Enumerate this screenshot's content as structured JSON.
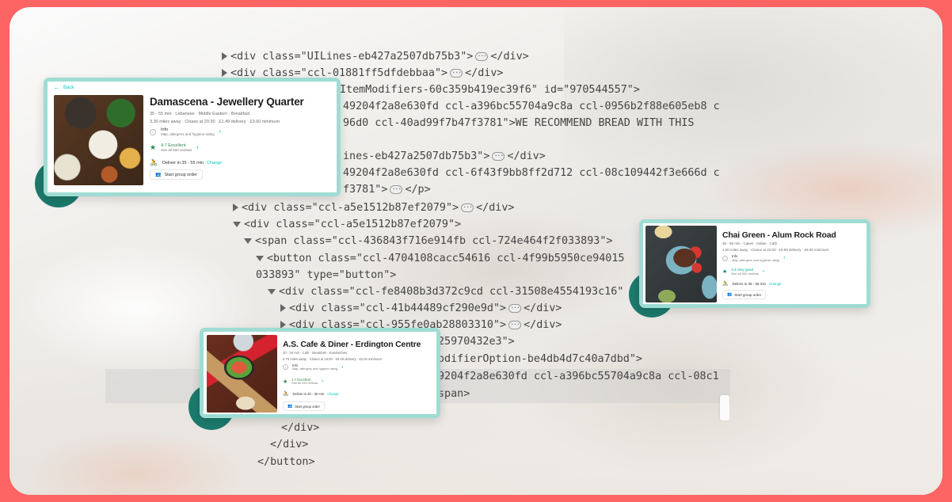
{
  "code_view": {
    "lines": [
      {
        "indent": 0,
        "toggle": "right",
        "text": "<div class=\"UILines-eb427a2507db75b3\">",
        "collapsed": true,
        "close": "</div>"
      },
      {
        "indent": 0,
        "toggle": "right",
        "text": "<div class=\"ccl-01881ff5dfdebbaa\">",
        "collapsed": true,
        "close": "</div>"
      },
      {
        "indent": 0,
        "toggle": "",
        "text": "ItemModifiers-60c359b419ec39f6\" id=\"970544557\">",
        "collapsed": false,
        "close": ""
      },
      {
        "indent": 0,
        "toggle": "",
        "text": "49204f2a8e630fd ccl-a396bc55704a9c8a ccl-0956b2f88e605eb8 c",
        "collapsed": false,
        "close": ""
      },
      {
        "indent": 0,
        "toggle": "",
        "text": "96d0 ccl-40ad99f7b47f3781\">WE RECOMMEND BREAD WITH THIS",
        "collapsed": false,
        "close": ""
      },
      {
        "indent": 0,
        "toggle": "",
        "text": "ines-eb427a2507db75b3\">",
        "collapsed": true,
        "close": "</div>"
      },
      {
        "indent": 0,
        "toggle": "",
        "text": "49204f2a8e630fd ccl-6f43f9bb8ff2d712 ccl-08c109442f3e666d c",
        "collapsed": false,
        "close": ""
      },
      {
        "indent": 0,
        "toggle": "",
        "text": "f3781\">",
        "collapsed": true,
        "close": "</p>"
      },
      {
        "indent": 0,
        "toggle": "right",
        "text": "<div class=\"ccl-a5e1512b87ef2079\">",
        "collapsed": true,
        "close": "</div>"
      },
      {
        "indent": 0,
        "toggle": "down",
        "text": "<div class=\"ccl-a5e1512b87ef2079\">",
        "collapsed": false,
        "close": ""
      },
      {
        "indent": 1,
        "toggle": "down",
        "text": "<span class=\"ccl-436843f716e914fb ccl-724e464f2f033893\">",
        "collapsed": false,
        "close": ""
      },
      {
        "indent": 2,
        "toggle": "down",
        "text": "<button class=\"ccl-4704108cacc54616 ccl-4f99b5950ce94015",
        "collapsed": false,
        "close": ""
      },
      {
        "indent": 2,
        "toggle": "",
        "text": "033893\" type=\"button\">",
        "collapsed": false,
        "close": ""
      },
      {
        "indent": 3,
        "toggle": "down",
        "text": "<div class=\"ccl-fe8408b3d372c9cd ccl-31508e4554193c16\"",
        "collapsed": false,
        "close": ""
      },
      {
        "indent": 4,
        "toggle": "right",
        "text": "<div class=\"ccl-41b44489cf290e9d\">",
        "collapsed": true,
        "close": "</div>"
      },
      {
        "indent": 4,
        "toggle": "right",
        "text": "<div class=\"ccl-955fe0ab28803310\">",
        "collapsed": true,
        "close": "</div>"
      },
      {
        "indent": 0,
        "toggle": "",
        "text": "25970432e3\">",
        "collapsed": false,
        "close": ""
      },
      {
        "indent": 0,
        "toggle": "",
        "text": "odifierOption-be4db4d7c40a7dbd\">",
        "collapsed": false,
        "close": ""
      },
      {
        "indent": 0,
        "toggle": "",
        "text": "9204f2a8e630fd ccl-a396bc55704a9c8a ccl-08c1",
        "collapsed": false,
        "close": ""
      },
      {
        "indent": 0,
        "toggle": "",
        "text": "span>",
        "collapsed": false,
        "close": ""
      },
      {
        "indent": 0,
        "toggle": "",
        "text": "</div>",
        "collapsed": false,
        "close": ""
      },
      {
        "indent": 0,
        "toggle": "",
        "text": "</div>",
        "collapsed": false,
        "close": ""
      },
      {
        "indent": 0,
        "toggle": "",
        "text": "</button>",
        "collapsed": false,
        "close": ""
      }
    ],
    "ellipsis_label": "···"
  },
  "cards": [
    {
      "back_label": "Back",
      "name": "Damascena - Jewellery Quarter",
      "meta1": "35 - 55 min · Lebanese · Middle Eastern · Breakfast",
      "meta2": "3.30 miles away · Closes at 20:30 · £1.49 delivery · £9.60 minimum",
      "info_label": "Info",
      "info_sub": "Map, allergens and hygiene rating",
      "rating_label": "4.7 Excellent",
      "rating_sub": "See all 500 reviews",
      "deliver_label": "Deliver in 35 - 55 min",
      "change_label": "Change",
      "group_order_label": "Start group order",
      "rating_color": "#2e8a48"
    },
    {
      "name": "Chai Green - Alum Rock Road",
      "meta1": "35 - 55 min · Cakes · Indian · Café",
      "meta2": "1.90 miles away · Closes at 22:00 · £0.99 delivery · £9.00 minimum",
      "info_label": "Info",
      "info_sub": "Map, allergens and hygiene rating",
      "rating_label": "4.3 Very good",
      "rating_sub": "See all 500 reviews",
      "deliver_label": "Deliver in 35 - 55 min",
      "change_label": "Change",
      "group_order_label": "Start group order",
      "rating_color": "#00a699"
    },
    {
      "name": "A.S. Cafe & Diner - Erdington Centre",
      "meta1": "20 - 30 min · Café · Breakfast · Sandwiches",
      "meta2": "0.70 miles away · Closes at 16:00 · £0.49 delivery · £5.00 minimum",
      "info_label": "Info",
      "info_sub": "Map, allergens and hygiene rating",
      "rating_label": "4.7 Excellent",
      "rating_sub": "See all 233 reviews",
      "deliver_label": "Deliver in 20 - 30 min",
      "change_label": "Change",
      "group_order_label": "Start group order",
      "rating_color": "#2e8a48"
    }
  ],
  "colors": {
    "border": "#fd6464",
    "card_frame": "#9fdcd3",
    "bubble": "#1c7a6c",
    "accent": "#00ccbc"
  }
}
